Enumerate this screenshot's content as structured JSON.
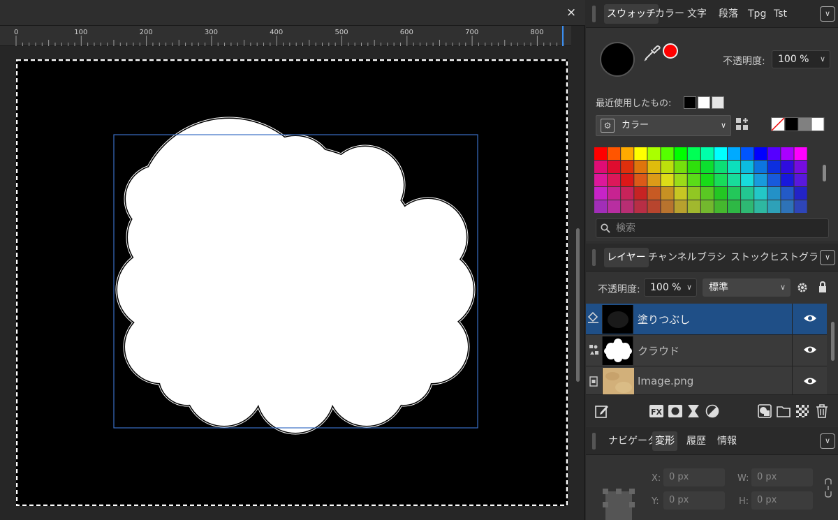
{
  "document": {
    "close_glyph": "×"
  },
  "ruler": {
    "labels": [
      "0",
      "100",
      "200",
      "300",
      "400",
      "500",
      "600",
      "700",
      "800"
    ]
  },
  "swatches_panel": {
    "tabs": [
      "スウォッチ",
      "カラー",
      "文字",
      "段落",
      "Tpg",
      "Tst"
    ],
    "active_tab": "スウォッチ",
    "current_color": "#000000",
    "secondary_color": "#ff0000",
    "opacity_label": "不透明度:",
    "opacity_value": "100 %",
    "recent_label": "最近使用したもの:",
    "recent_colors": [
      "#000000",
      "#ffffff",
      "#e6e6e6"
    ],
    "palette_name": "カラー",
    "quick_colors": [
      "none",
      "#000000",
      "#808080",
      "#ffffff"
    ],
    "search_placeholder": "検索"
  },
  "layers_panel": {
    "tabs": [
      "レイヤー",
      "チャンネル",
      "ブラシ",
      "ストック",
      "ヒストグラム"
    ],
    "active_tab": "レイヤー",
    "opacity_label": "不透明度:",
    "opacity_value": "100 %",
    "blend_mode": "標準",
    "layers": [
      {
        "name": "塗りつぶし",
        "selected": true,
        "visible": true,
        "type": "fill"
      },
      {
        "name": "クラウド",
        "selected": false,
        "visible": true,
        "type": "shape"
      },
      {
        "name": "Image.png",
        "selected": false,
        "visible": true,
        "type": "image"
      }
    ]
  },
  "transform_panel": {
    "tabs": [
      "ナビゲータ",
      "変形",
      "履歴",
      "情報"
    ],
    "active_tab": "変形",
    "fields": {
      "x_label": "X:",
      "x_value": "0 px",
      "y_label": "Y:",
      "y_value": "0 px",
      "w_label": "W:",
      "w_value": "0 px",
      "h_label": "H:",
      "h_value": "0 px"
    }
  },
  "colors": {
    "selection_blue": "#1f4f87",
    "bbox_blue": "#3a6fc4"
  }
}
